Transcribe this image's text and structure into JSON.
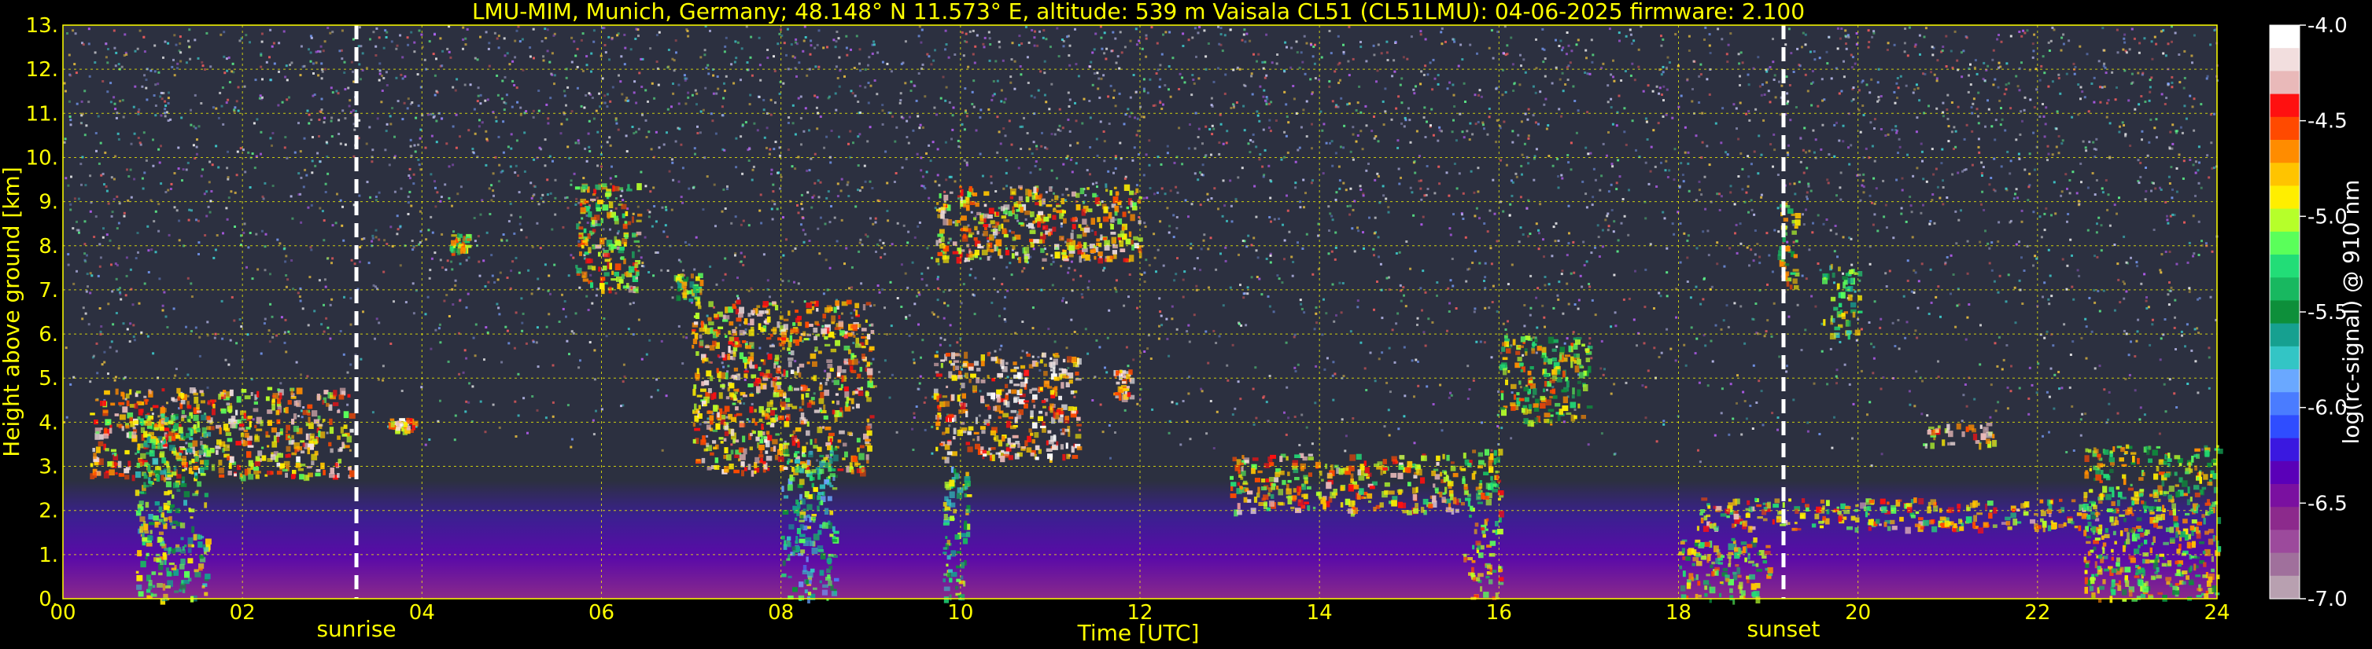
{
  "chart_data": {
    "type": "heatmap",
    "title": "LMU-MIM, Munich, Germany; 48.148° N 11.573° E, altitude: 539 m    Vaisala CL51 (CL51LMU): 04-06-2025    firmware: 2.100",
    "xlabel": "Time [UTC]",
    "ylabel": "Height above ground [km]",
    "xlim": [
      0,
      24
    ],
    "ylim": [
      0,
      13
    ],
    "x_ticks": [
      "00",
      "02",
      "04",
      "06",
      "08",
      "10",
      "12",
      "14",
      "16",
      "18",
      "20",
      "22",
      "24"
    ],
    "x_tick_values": [
      0,
      2,
      4,
      6,
      8,
      10,
      12,
      14,
      16,
      18,
      20,
      22,
      24
    ],
    "y_ticks": [
      "0.",
      "1.",
      "2.",
      "3.",
      "4.",
      "5.",
      "6.",
      "7.",
      "8.",
      "9.",
      "10.",
      "11.",
      "12.",
      "13."
    ],
    "y_tick_values": [
      0,
      1,
      2,
      3,
      4,
      5,
      6,
      7,
      8,
      9,
      10,
      11,
      12,
      13
    ],
    "grid": true,
    "markers": [
      {
        "label": "sunrise",
        "x": 3.27
      },
      {
        "label": "sunset",
        "x": 19.17
      }
    ],
    "colorbar": {
      "label": "log(rc-signal) @ 910 nm",
      "range": [
        -7.0,
        -4.0
      ],
      "ticks": [
        "-4.0",
        "-4.5",
        "-5.0",
        "-5.5",
        "-6.0",
        "-6.5",
        "-7.0"
      ],
      "tick_values": [
        -4.0,
        -4.5,
        -5.0,
        -5.5,
        -6.0,
        -6.5,
        -7.0
      ],
      "colors": [
        "#ffffff",
        "#f2dede",
        "#e9b9b9",
        "#ff1010",
        "#ff4a00",
        "#ff8c00",
        "#ffc400",
        "#ffee00",
        "#b6ff2a",
        "#5aff5a",
        "#22dd77",
        "#18b860",
        "#0d8f3a",
        "#16a090",
        "#33c5c5",
        "#6aa8ff",
        "#4a7cff",
        "#2f4dff",
        "#3a18e0",
        "#5a00b8",
        "#7a10a0",
        "#8c2a8c",
        "#9c4a9c",
        "#a0709c",
        "#b8a0b0"
      ]
    },
    "features": [
      {
        "x0": 0.3,
        "x1": 3.2,
        "y0": 2.8,
        "y1": 4.8,
        "level": -4.6
      },
      {
        "x0": 0.8,
        "x1": 1.6,
        "y0": 0.0,
        "y1": 4.2,
        "level": -5.2
      },
      {
        "x0": 3.6,
        "x1": 3.9,
        "y0": 3.8,
        "y1": 4.1,
        "level": -4.5
      },
      {
        "x0": 4.3,
        "x1": 4.5,
        "y0": 7.9,
        "y1": 8.3,
        "level": -5.0
      },
      {
        "x0": 5.7,
        "x1": 6.4,
        "y0": 7.0,
        "y1": 9.5,
        "level": -4.8
      },
      {
        "x0": 6.8,
        "x1": 7.1,
        "y0": 6.8,
        "y1": 7.4,
        "level": -5.1
      },
      {
        "x0": 7.0,
        "x1": 9.0,
        "y0": 2.9,
        "y1": 6.8,
        "level": -4.6
      },
      {
        "x0": 8.0,
        "x1": 8.6,
        "y0": 0.0,
        "y1": 3.5,
        "level": -5.4
      },
      {
        "x0": 9.7,
        "x1": 11.3,
        "y0": 3.2,
        "y1": 5.6,
        "level": -4.4
      },
      {
        "x0": 9.8,
        "x1": 10.1,
        "y0": 0.0,
        "y1": 3.0,
        "level": -5.3
      },
      {
        "x0": 9.7,
        "x1": 12.0,
        "y0": 7.7,
        "y1": 9.4,
        "level": -4.6
      },
      {
        "x0": 11.7,
        "x1": 11.9,
        "y0": 4.6,
        "y1": 5.2,
        "level": -4.4
      },
      {
        "x0": 13.0,
        "x1": 15.6,
        "y0": 2.0,
        "y1": 3.3,
        "level": -4.7
      },
      {
        "x0": 15.6,
        "x1": 16.0,
        "y0": 0.0,
        "y1": 3.4,
        "level": -4.9
      },
      {
        "x0": 16.0,
        "x1": 17.0,
        "y0": 4.0,
        "y1": 6.0,
        "level": -5.0
      },
      {
        "x0": 18.0,
        "x1": 19.0,
        "y0": 0.0,
        "y1": 1.4,
        "level": -5.0
      },
      {
        "x0": 18.2,
        "x1": 22.7,
        "y0": 1.6,
        "y1": 2.3,
        "level": -4.8
      },
      {
        "x0": 19.1,
        "x1": 19.3,
        "y0": 7.0,
        "y1": 9.0,
        "level": -5.0
      },
      {
        "x0": 19.6,
        "x1": 20.0,
        "y0": 6.0,
        "y1": 7.6,
        "level": -5.2
      },
      {
        "x0": 20.7,
        "x1": 21.5,
        "y0": 3.5,
        "y1": 4.0,
        "level": -4.6
      },
      {
        "x0": 22.5,
        "x1": 24.0,
        "y0": 0.0,
        "y1": 3.5,
        "level": -5.0
      }
    ]
  }
}
